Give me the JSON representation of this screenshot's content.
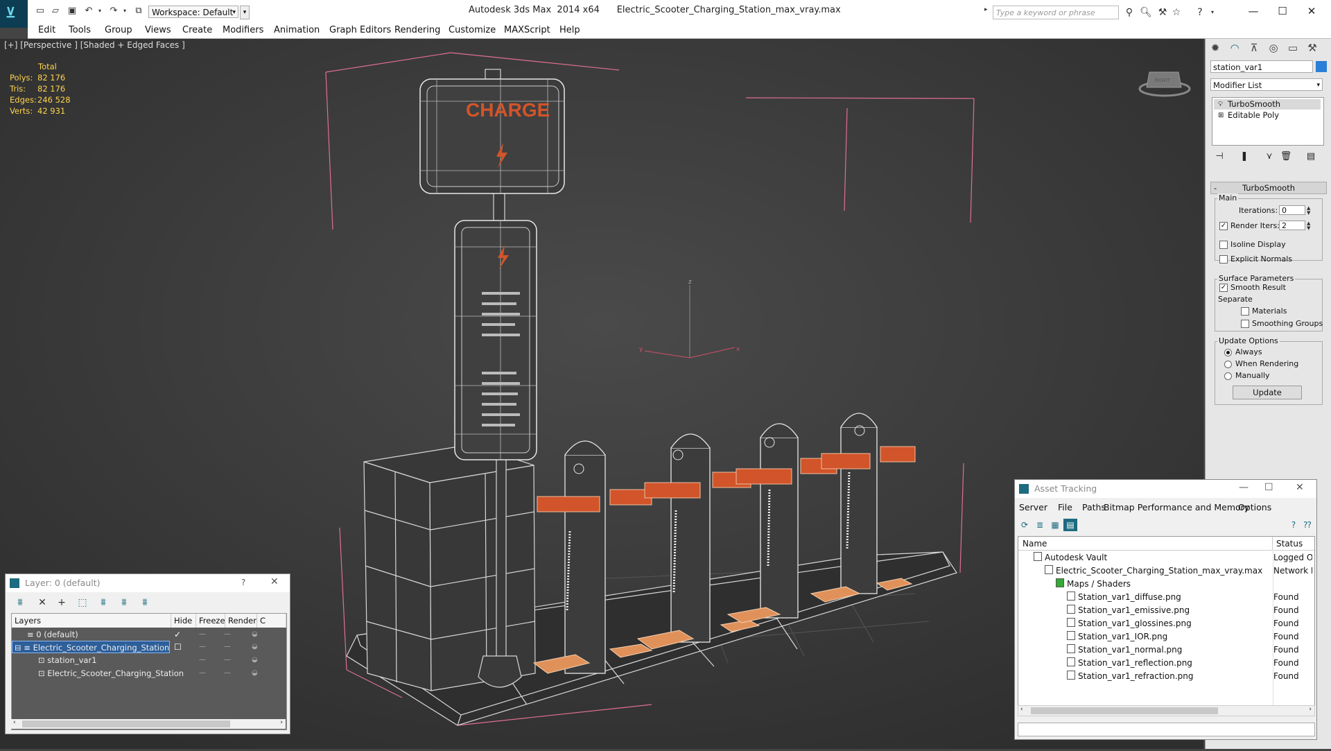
{
  "titlebar": {
    "app_title": "Autodesk 3ds Max  2014 x64",
    "file_name": "Electric_Scooter_Charging_Station_max_vray.max",
    "workspace_label": "Workspace: Default",
    "search_placeholder": "Type a keyword or phrase"
  },
  "menubar": {
    "items": [
      "Edit",
      "Tools",
      "Group",
      "Views",
      "Create",
      "Modifiers",
      "Animation",
      "Graph Editors",
      "Rendering",
      "Customize",
      "MAXScript",
      "Help"
    ]
  },
  "viewport": {
    "label": "[+] [Perspective ] [Shaded + Edged Faces ]",
    "sign_text": "CHARGE",
    "stats": {
      "header": "Total",
      "rows": [
        {
          "label": "Polys:",
          "value": "82 176"
        },
        {
          "label": "Tris:",
          "value": "82 176"
        },
        {
          "label": "Edges:",
          "value": "246 528"
        },
        {
          "label": "Verts:",
          "value": "42 931"
        }
      ]
    },
    "gizmo": {
      "x": "x",
      "y": "y",
      "z": "z"
    },
    "viewcube_label": "RIGHT"
  },
  "command_panel": {
    "object_name": "station_var1",
    "object_color": "#2a7fd6",
    "modifier_list": "Modifier List",
    "stack": [
      "TurboSmooth",
      "Editable Poly"
    ],
    "turbosmooth": {
      "title": "TurboSmooth",
      "main_title": "Main",
      "iterations_label": "Iterations:",
      "iterations_value": "0",
      "render_iters_label": "Render Iters:",
      "render_iters_value": "2",
      "isoline_label": "Isoline Display",
      "explicit_label": "Explicit Normals",
      "surface_title": "Surface Parameters",
      "smooth_label": "Smooth Result",
      "separate_label": "Separate",
      "materials_label": "Materials",
      "smoothing_label": "Smoothing Groups",
      "update_title": "Update Options",
      "always_label": "Always",
      "when_render_label": "When Rendering",
      "manually_label": "Manually",
      "update_button": "Update"
    }
  },
  "asset_tracking": {
    "title": "Asset Tracking",
    "menu": [
      "Server",
      "File",
      "Paths",
      "Bitmap Performance and Memory",
      "Options"
    ],
    "col_name": "Name",
    "col_status": "Status",
    "rows": [
      {
        "name": "Autodesk Vault",
        "status": "Logged O",
        "indent": 0
      },
      {
        "name": "Electric_Scooter_Charging_Station_max_vray.max",
        "status": "Network I",
        "indent": 1
      },
      {
        "name": "Maps / Shaders",
        "status": "",
        "indent": 2
      },
      {
        "name": "Station_var1_diffuse.png",
        "status": "Found",
        "indent": 3
      },
      {
        "name": "Station_var1_emissive.png",
        "status": "Found",
        "indent": 3
      },
      {
        "name": "Station_var1_glossines.png",
        "status": "Found",
        "indent": 3
      },
      {
        "name": "Station_var1_IOR.png",
        "status": "Found",
        "indent": 3
      },
      {
        "name": "Station_var1_normal.png",
        "status": "Found",
        "indent": 3
      },
      {
        "name": "Station_var1_reflection.png",
        "status": "Found",
        "indent": 3
      },
      {
        "name": "Station_var1_refraction.png",
        "status": "Found",
        "indent": 3
      }
    ]
  },
  "layer_window": {
    "title": "Layer: 0 (default)",
    "help": "?",
    "cols": {
      "layers": "Layers",
      "hide": "Hide",
      "freeze": "Freeze",
      "render": "Render",
      "c": "C"
    },
    "rows": [
      {
        "name": "0 (default)",
        "indent": 1,
        "selected": false
      },
      {
        "name": "Electric_Scooter_Charging_Station",
        "indent": 1,
        "selected": true
      },
      {
        "name": "station_var1",
        "indent": 2,
        "selected": false
      },
      {
        "name": "Electric_Scooter_Charging_Station",
        "indent": 2,
        "selected": false
      }
    ]
  }
}
